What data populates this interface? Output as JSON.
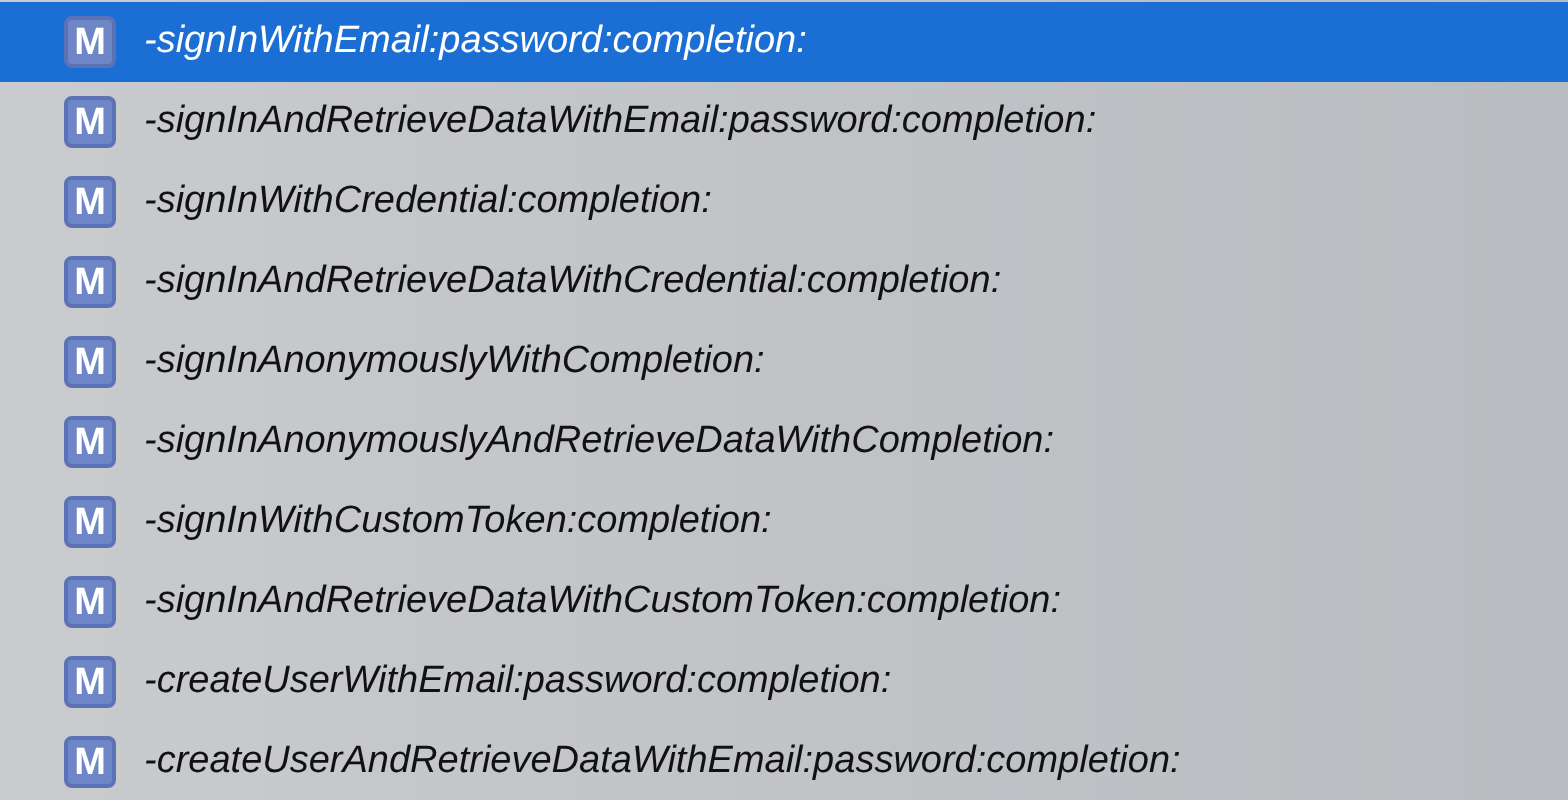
{
  "completions": [
    {
      "badge": "M",
      "label": "-signInWithEmail:password:completion:",
      "selected": true
    },
    {
      "badge": "M",
      "label": "-signInAndRetrieveDataWithEmail:password:completion:",
      "selected": false
    },
    {
      "badge": "M",
      "label": "-signInWithCredential:completion:",
      "selected": false
    },
    {
      "badge": "M",
      "label": "-signInAndRetrieveDataWithCredential:completion:",
      "selected": false
    },
    {
      "badge": "M",
      "label": "-signInAnonymouslyWithCompletion:",
      "selected": false
    },
    {
      "badge": "M",
      "label": "-signInAnonymouslyAndRetrieveDataWithCompletion:",
      "selected": false
    },
    {
      "badge": "M",
      "label": "-signInWithCustomToken:completion:",
      "selected": false
    },
    {
      "badge": "M",
      "label": "-signInAndRetrieveDataWithCustomToken:completion:",
      "selected": false
    },
    {
      "badge": "M",
      "label": "-createUserWithEmail:password:completion:",
      "selected": false
    },
    {
      "badge": "M",
      "label": "-createUserAndRetrieveDataWithEmail:password:completion:",
      "selected": false
    }
  ]
}
